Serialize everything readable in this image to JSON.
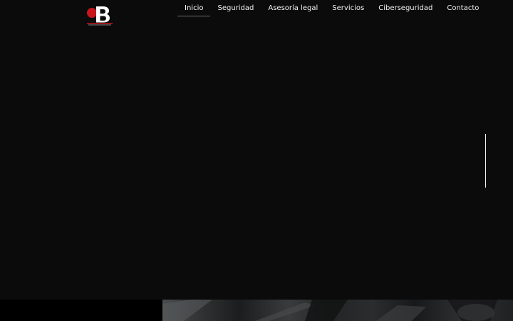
{
  "header": {
    "logo": {
      "name": "logo",
      "letter": "B",
      "accent_color": "#c8161d"
    },
    "nav": [
      {
        "label": "Inicio",
        "active": true
      },
      {
        "label": "Seguridad",
        "active": false
      },
      {
        "label": "Asesoría legal",
        "active": false
      },
      {
        "label": "Servicios",
        "active": false
      },
      {
        "label": "Ciberseguridad",
        "active": false
      },
      {
        "label": "Contacto",
        "active": false
      }
    ]
  },
  "hero": {
    "background_color": "#0b0b0b",
    "slider_indicator_color": "#f5f5f5"
  },
  "colors": {
    "nav_text": "#f2f2f2",
    "active_underline": "#6f6f6f"
  }
}
